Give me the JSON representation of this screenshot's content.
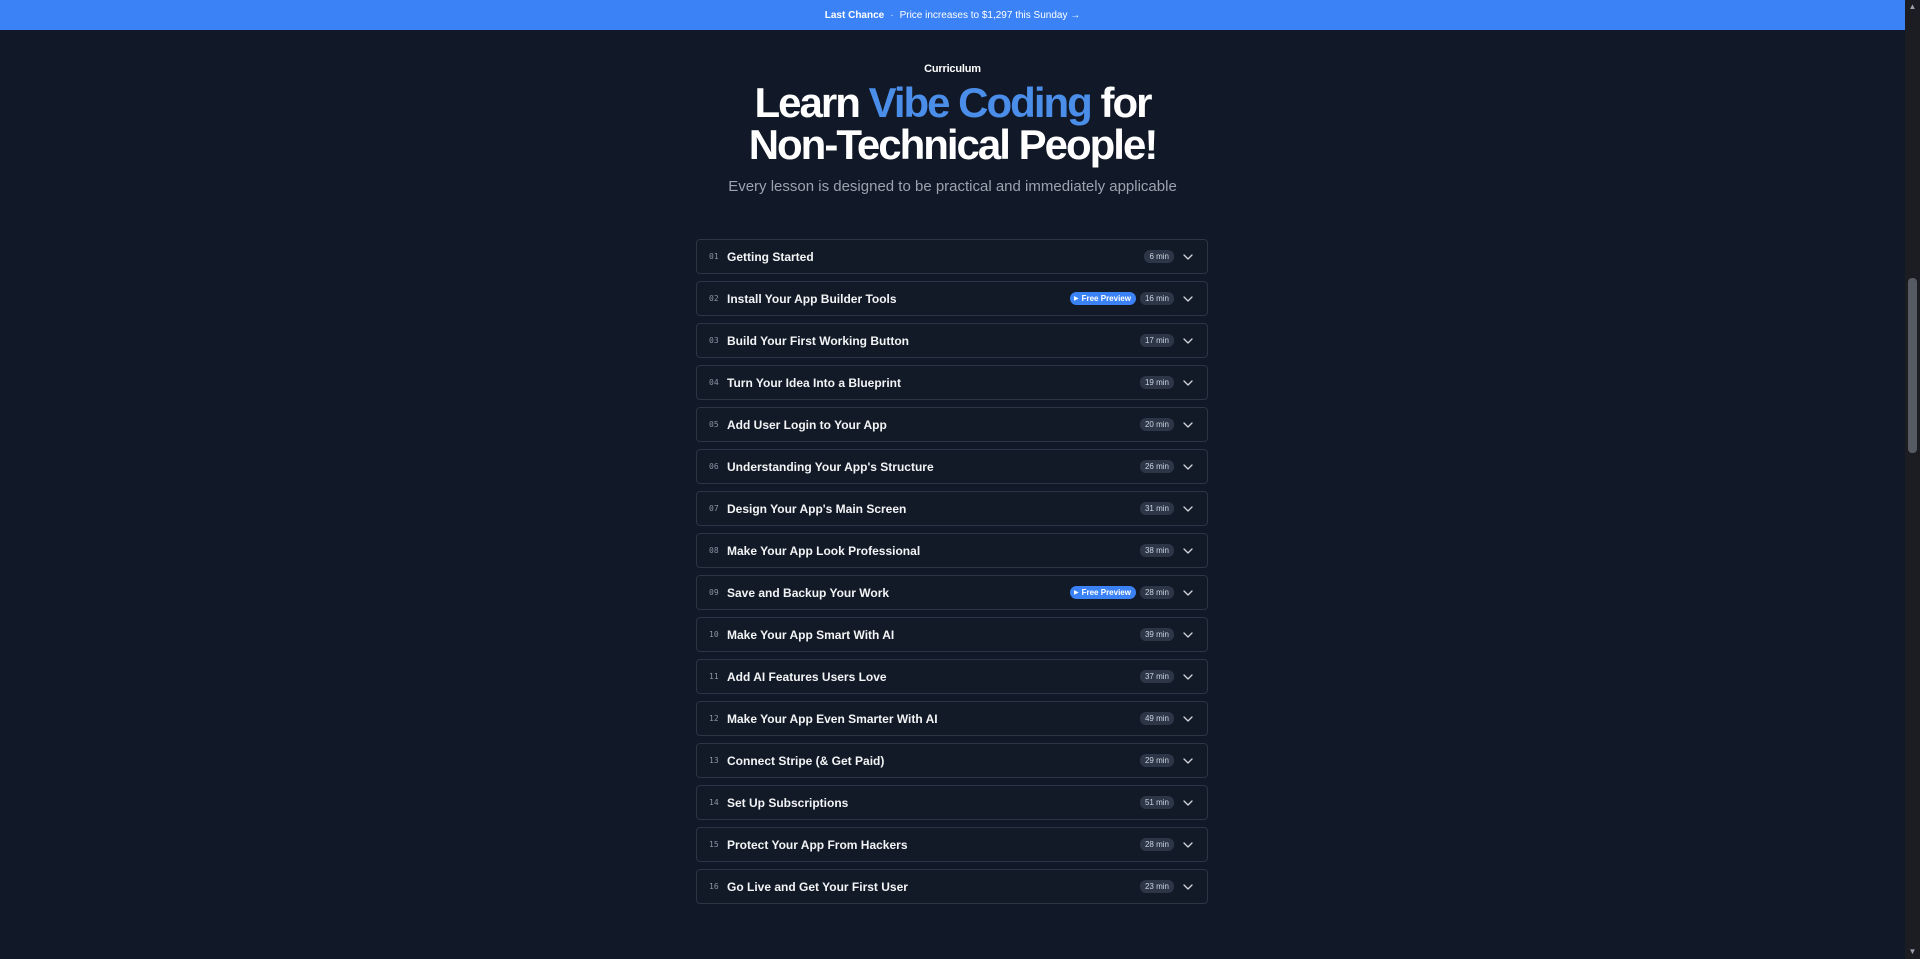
{
  "banner": {
    "strong": "Last Chance",
    "separator": "·",
    "message": "Price increases to $1,297 this Sunday →"
  },
  "header": {
    "eyebrow": "Curriculum",
    "headline_part1": "Learn ",
    "headline_accent": "Vibe Coding",
    "headline_part2": " for",
    "headline_line2": "Non-Technical People!",
    "subtitle": "Every lesson is designed to be practical and immediately applicable"
  },
  "badge_label": "Free Preview",
  "lessons": [
    {
      "num": "01",
      "title": "Getting Started",
      "duration": "6 min",
      "preview": false
    },
    {
      "num": "02",
      "title": "Install Your App Builder Tools",
      "duration": "16 min",
      "preview": true
    },
    {
      "num": "03",
      "title": "Build Your First Working Button",
      "duration": "17 min",
      "preview": false
    },
    {
      "num": "04",
      "title": "Turn Your Idea Into a Blueprint",
      "duration": "19 min",
      "preview": false
    },
    {
      "num": "05",
      "title": "Add User Login to Your App",
      "duration": "20 min",
      "preview": false
    },
    {
      "num": "06",
      "title": "Understanding Your App's Structure",
      "duration": "26 min",
      "preview": false
    },
    {
      "num": "07",
      "title": "Design Your App's Main Screen",
      "duration": "31 min",
      "preview": false
    },
    {
      "num": "08",
      "title": "Make Your App Look Professional",
      "duration": "38 min",
      "preview": false
    },
    {
      "num": "09",
      "title": "Save and Backup Your Work",
      "duration": "28 min",
      "preview": true
    },
    {
      "num": "10",
      "title": "Make Your App Smart With AI",
      "duration": "39 min",
      "preview": false
    },
    {
      "num": "11",
      "title": "Add AI Features Users Love",
      "duration": "37 min",
      "preview": false
    },
    {
      "num": "12",
      "title": "Make Your App Even Smarter With AI",
      "duration": "49 min",
      "preview": false
    },
    {
      "num": "13",
      "title": "Connect Stripe (& Get Paid)",
      "duration": "29 min",
      "preview": false
    },
    {
      "num": "14",
      "title": "Set Up Subscriptions",
      "duration": "51 min",
      "preview": false
    },
    {
      "num": "15",
      "title": "Protect Your App From Hackers",
      "duration": "28 min",
      "preview": false
    },
    {
      "num": "16",
      "title": "Go Live and Get Your First User",
      "duration": "23 min",
      "preview": false
    }
  ],
  "icons": {
    "expand": "chevron-down-icon",
    "play": "play-icon"
  },
  "colors": {
    "background": "#111827",
    "banner": "#3b82f6",
    "accent": "#4a8eea"
  }
}
